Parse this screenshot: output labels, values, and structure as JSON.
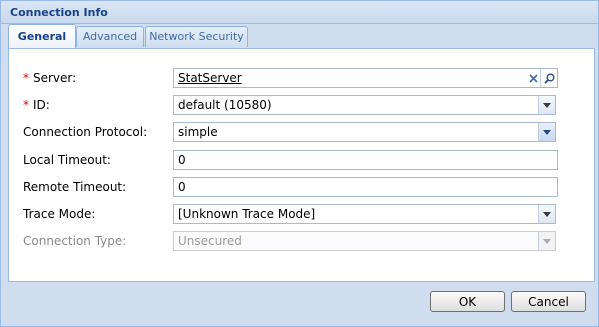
{
  "dialog": {
    "title": "Connection Info",
    "tabs": [
      {
        "label": "General",
        "active": true
      },
      {
        "label": "Advanced",
        "active": false
      },
      {
        "label": "Network Security",
        "active": false
      }
    ],
    "fields": {
      "server": {
        "label": "Server:",
        "required_mark": "*",
        "value": "StatServer"
      },
      "id": {
        "label": "ID:",
        "required_mark": "*",
        "value": "default (10580)"
      },
      "connection_protocol": {
        "label": "Connection Protocol:",
        "value": "simple"
      },
      "local_timeout": {
        "label": "Local Timeout:",
        "value": "0"
      },
      "remote_timeout": {
        "label": "Remote Timeout:",
        "value": "0"
      },
      "trace_mode": {
        "label": "Trace Mode:",
        "value": "[Unknown Trace Mode]"
      },
      "connection_type": {
        "label": "Connection Type:",
        "value": "Unsecured"
      }
    },
    "buttons": {
      "ok": "OK",
      "cancel": "Cancel"
    },
    "icons": {
      "clear": "close-icon",
      "browse": "search-icon",
      "dropdown": "chevron-down-icon"
    },
    "colors": {
      "title": "#15428b",
      "accent_border": "#99bbe8",
      "required": "#dd0000"
    }
  }
}
